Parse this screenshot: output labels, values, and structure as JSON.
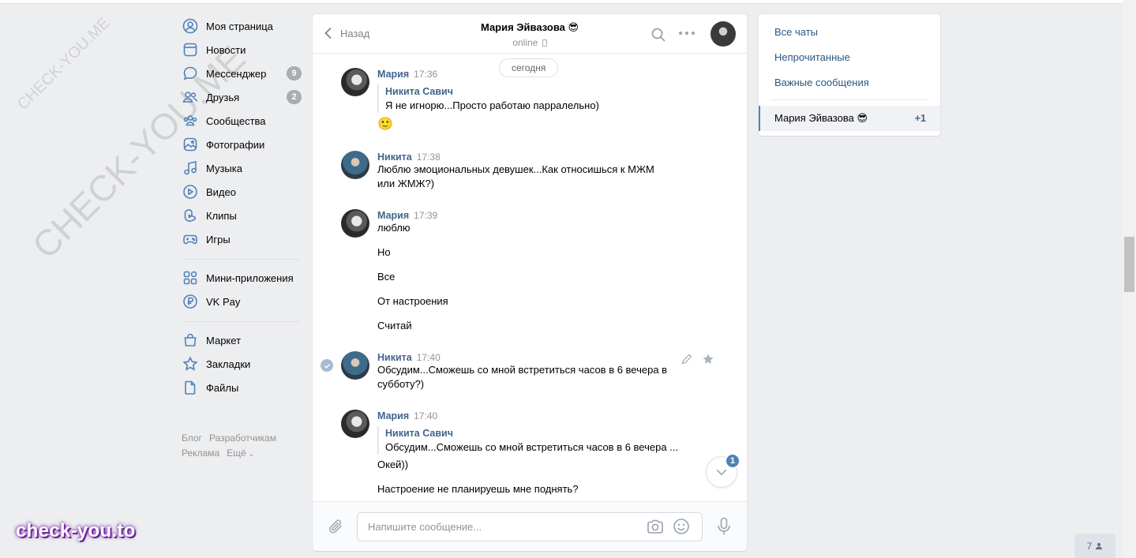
{
  "watermark": {
    "small": "CHECK-YOU.ME",
    "large": "CHECK-YOU.ME",
    "brand": "check-you.to"
  },
  "nav": {
    "items": [
      {
        "label": "Моя страница",
        "icon": "user-circle-icon"
      },
      {
        "label": "Новости",
        "icon": "newspaper-icon"
      },
      {
        "label": "Мессенджер",
        "icon": "chat-bubble-icon",
        "badge": "9"
      },
      {
        "label": "Друзья",
        "icon": "friends-icon",
        "badge": "2"
      },
      {
        "label": "Сообщества",
        "icon": "communities-icon"
      },
      {
        "label": "Фотографии",
        "icon": "photo-icon"
      },
      {
        "label": "Музыка",
        "icon": "music-note-icon"
      },
      {
        "label": "Видео",
        "icon": "play-circle-icon"
      },
      {
        "label": "Клипы",
        "icon": "clips-icon"
      },
      {
        "label": "Игры",
        "icon": "gamepad-icon"
      }
    ],
    "items2": [
      {
        "label": "Мини-приложения",
        "icon": "apps-grid-icon"
      },
      {
        "label": "VK Pay",
        "icon": "ruble-circle-icon"
      }
    ],
    "items3": [
      {
        "label": "Маркет",
        "icon": "shopping-bag-icon"
      },
      {
        "label": "Закладки",
        "icon": "star-icon"
      },
      {
        "label": "Файлы",
        "icon": "file-icon"
      }
    ],
    "footer": {
      "blog": "Блог",
      "dev": "Разработчикам",
      "ads": "Реклама",
      "more": "Ещё"
    }
  },
  "chat": {
    "back_label": "Назад",
    "name": "Мария Эйвазова 😎",
    "status": "online",
    "date_pill": "сегодня",
    "messages": [
      {
        "author": "Мария",
        "time": "17:36",
        "quote_author": "Никита Савич",
        "quote_text": "Я не игнорю...Просто работаю парралельно)",
        "emoji": "🙂"
      },
      {
        "author": "Никита",
        "time": "17:38",
        "text": "Люблю эмоциональных девушек...Как относишься к МЖМ или ЖМЖ?)"
      },
      {
        "author": "Мария",
        "time": "17:39",
        "lines": [
          "люблю",
          "Но",
          "Все",
          "От настроения",
          "Считай"
        ]
      },
      {
        "author": "Никита",
        "time": "17:40",
        "text": "Обсудим...Сможешь со мной встретиться часов в 6 вечера в субботу?)"
      },
      {
        "author": "Мария",
        "time": "17:40",
        "quote_author": "Никита Савич",
        "quote_text": "Обсудим...Сможешь со мной встретиться часов в 6 вечера ...",
        "lines": [
          "Окей))",
          "Настроение не планируешь мне поднять?"
        ]
      }
    ],
    "unread_badge": "1",
    "composer_placeholder": "Напишите сообщение..."
  },
  "right": {
    "all": "Все чаты",
    "unread": "Непрочитанные",
    "important": "Важные сообщения",
    "active_name": "Мария Эйвазова 😎",
    "active_count": "+1"
  },
  "online_count": "7"
}
